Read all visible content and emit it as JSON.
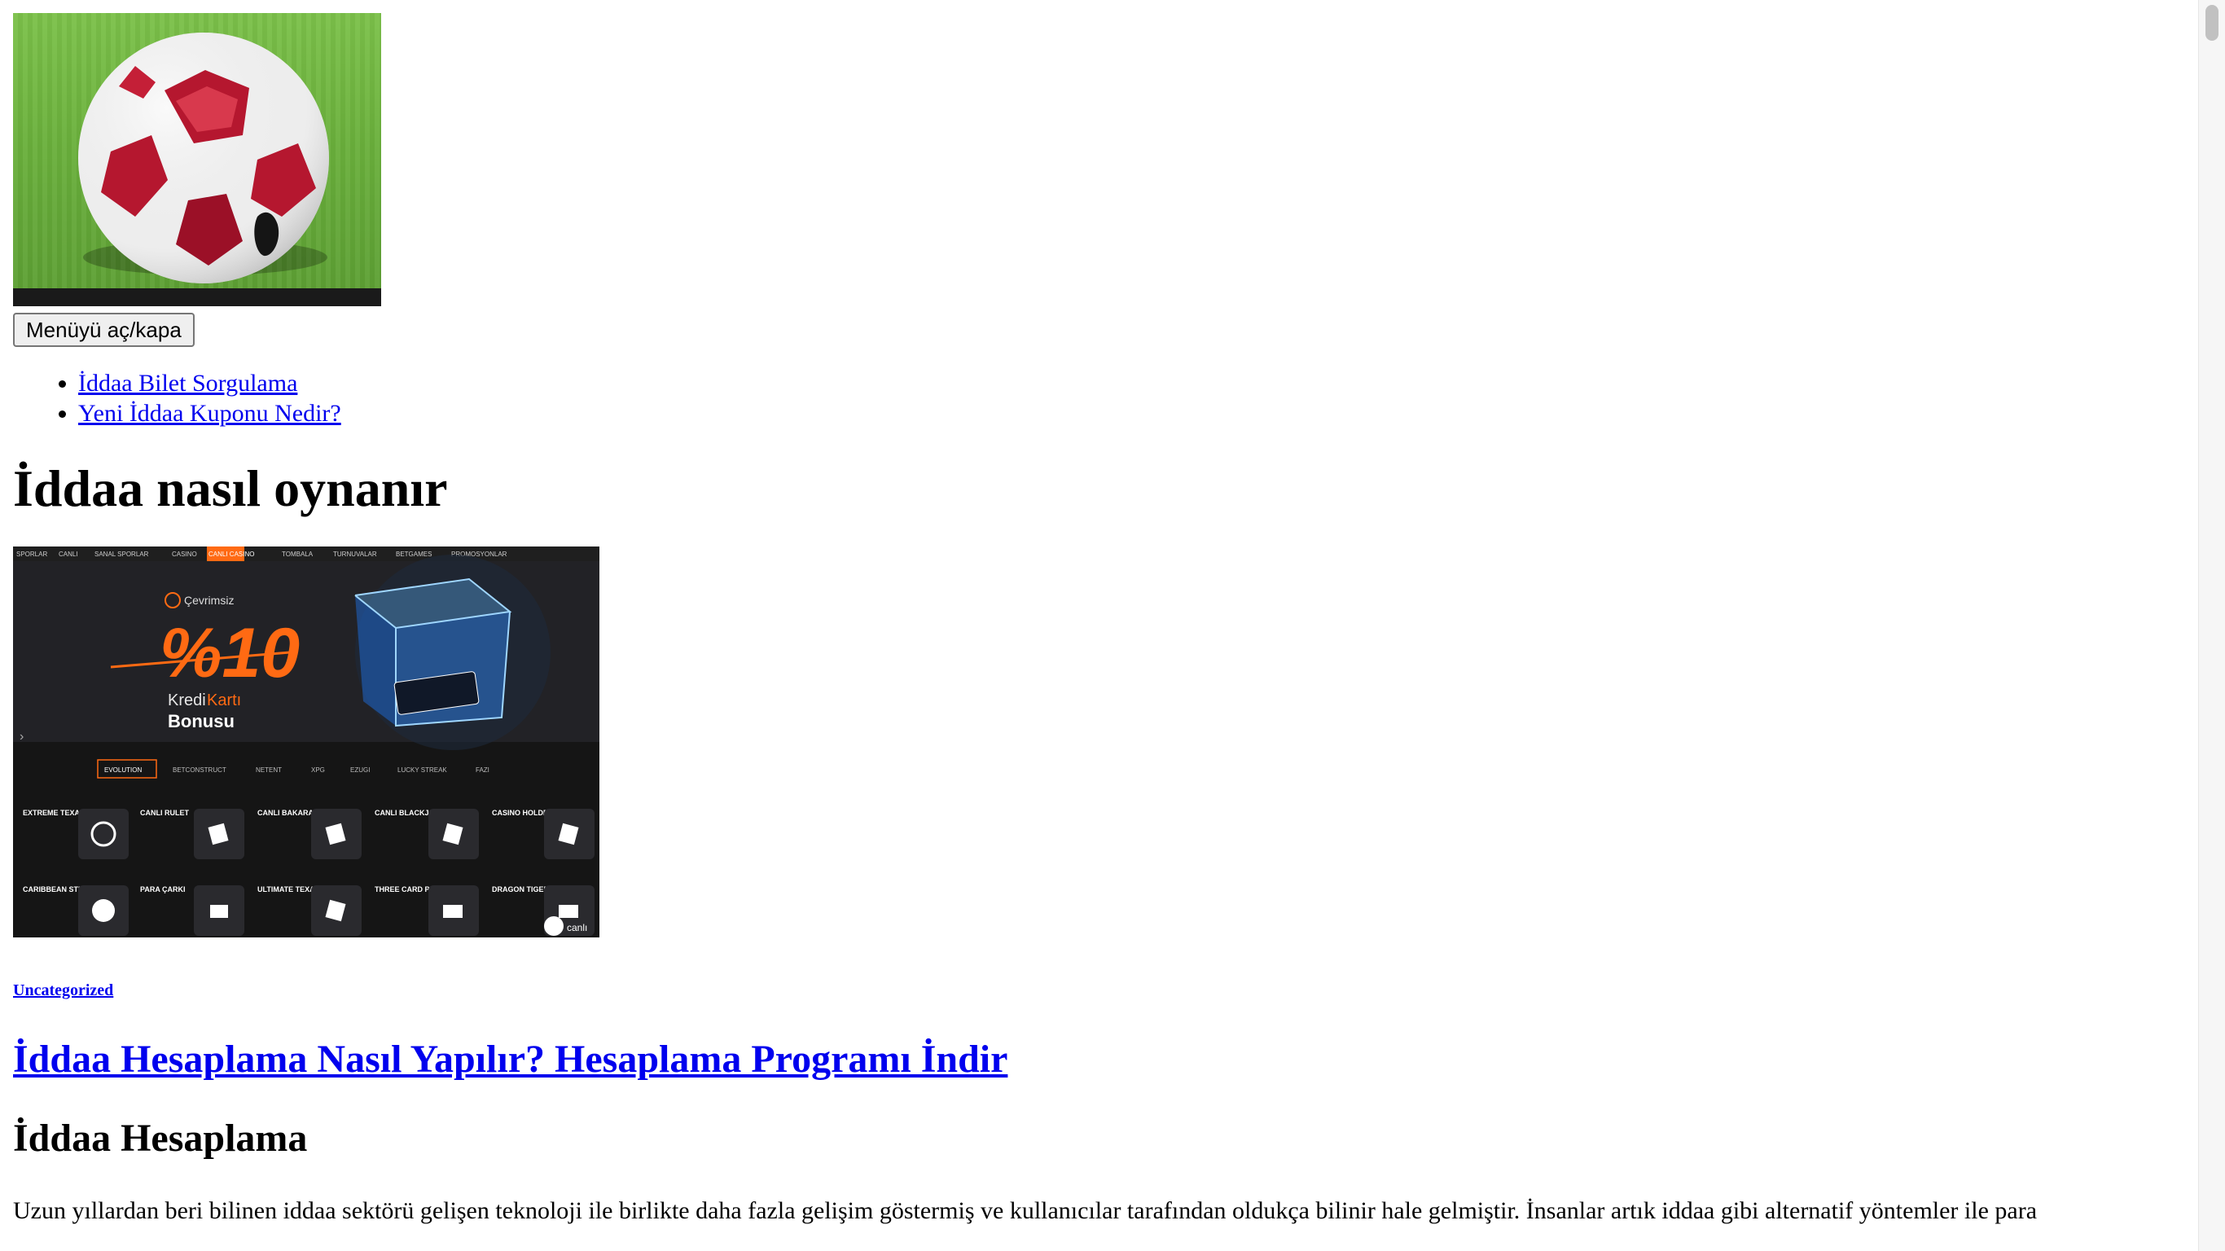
{
  "header": {
    "image_alt": "soccer ball",
    "menu_toggle_label": "Menüyü aç/kapa"
  },
  "menu": {
    "items": [
      {
        "label": "İddaa Bilet Sorgulama"
      },
      {
        "label": "Yeni İddaa Kuponu Nedir?"
      }
    ]
  },
  "site": {
    "title": "İddaa nasıl oynanır"
  },
  "post": {
    "thumb": {
      "top_nav": [
        "SPORLAR",
        "CANLI",
        "SANAL SPORLAR",
        "CASINO",
        "CANLI CASINO",
        "TOMBALA",
        "TURNUVALAR",
        "BETGAMES",
        "PROMOSYONLAR"
      ],
      "badge_text": "Çevrimsiz",
      "big_text": "%10",
      "sub_text_1": "Kredi",
      "sub_text_1b": "Kartı",
      "sub_text_2": "Bonusu",
      "providers": [
        "EVOLUTION",
        "BETCONSTRUCT",
        "NETENT",
        "XPG",
        "EZUGI",
        "LUCKY STREAK",
        "FAZI"
      ],
      "games_row1": [
        "EXTREME TEXAS HOLDEM",
        "CANLI RULET",
        "CANLI BAKARA",
        "CANLI BLACKJACK",
        "CASINO HOLDEM"
      ],
      "games_row2": [
        "CARIBBEAN STUD POKER",
        "PARA ÇARKI",
        "ULTIMATE TEXAS HOLDEM",
        "THREE CARD POKER",
        "DRAGON TIGER"
      ],
      "logo_text": "canlı"
    },
    "category": "Uncategorized",
    "title": "İddaa Hesaplama Nasıl Yapılır? Hesaplama Programı İndir",
    "subheading": "İddaa Hesaplama",
    "excerpt": "Uzun yıllardan beri bilinen iddaa sektörü gelişen teknoloji ile birlikte daha fazla gelişim göstermiş ve kullanıcılar tarafından oldukça bilinir hale gelmiştir. İnsanlar artık iddaa gibi alternatif yöntemler ile para"
  },
  "colors": {
    "link": "#0000ee",
    "thumb_accent": "#ff6a13",
    "thumb_bg": "#151515"
  }
}
